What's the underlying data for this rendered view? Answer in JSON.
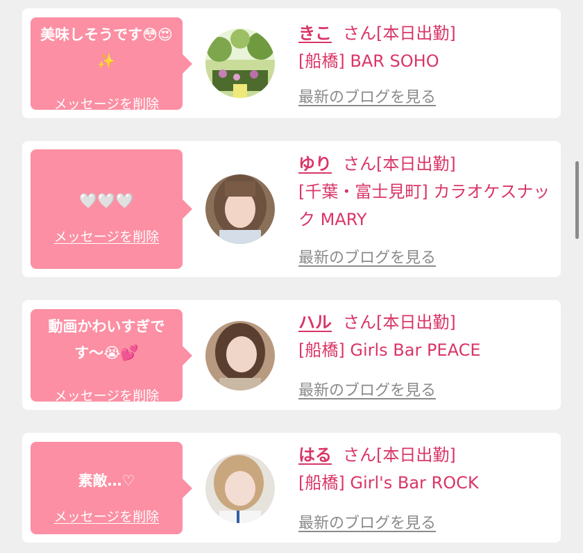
{
  "messages": [
    {
      "message": "美味しそうです😳😍✨",
      "delete_label": "メッセージを削除",
      "name": "きこ",
      "suffix": "さん[本日出勤]",
      "shop": "[船橋] BAR SOHO",
      "blog_label": "最新のブログを見る"
    },
    {
      "message": "🤍🤍🤍",
      "delete_label": "メッセージを削除",
      "name": "ゆり",
      "suffix": "さん[本日出勤]",
      "shop": "[千葉・富士見町] カラオケスナック MARY",
      "blog_label": "最新のブログを見る"
    },
    {
      "message": "動画かわいすぎです〜😭💕",
      "delete_label": "メッセージを削除",
      "name": "ハル",
      "suffix": "さん[本日出勤]",
      "shop": "[船橋] Girls Bar PEACE",
      "blog_label": "最新のブログを見る"
    },
    {
      "message": "素敵…♡",
      "delete_label": "メッセージを削除",
      "name": "はる",
      "suffix": "さん[本日出勤]",
      "shop": "[船橋] Girl's Bar ROCK",
      "blog_label": "最新のブログを見る"
    }
  ],
  "colors": {
    "background": "#efefef",
    "card": "#ffffff",
    "bubble": "#fc8fa3",
    "accent": "#d93566",
    "link_gray": "#8a8a8a"
  }
}
